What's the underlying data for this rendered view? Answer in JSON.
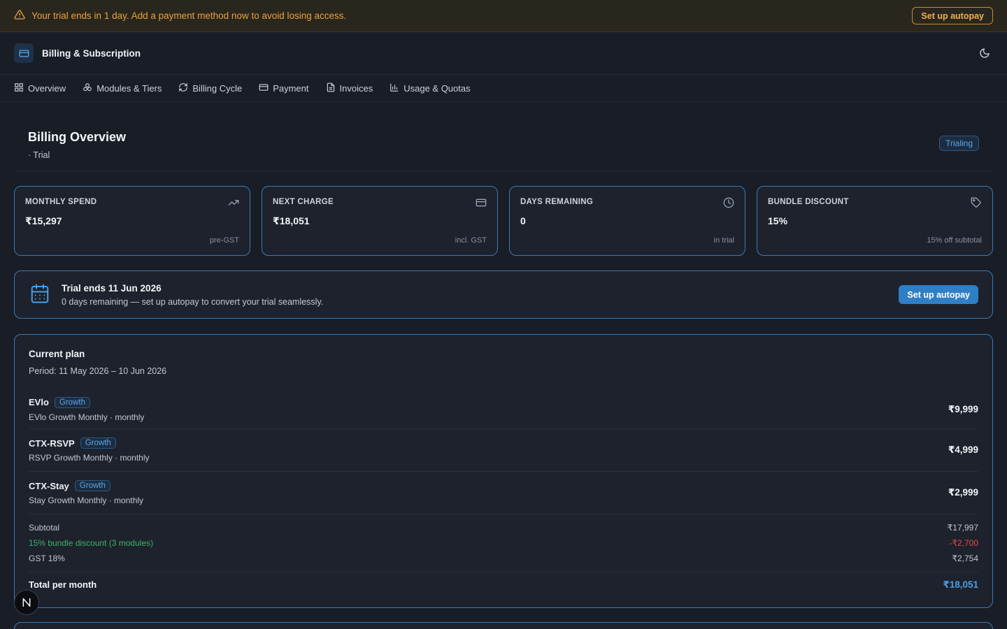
{
  "banner": {
    "message": "Your trial ends in 1 day. Add a payment method now to avoid losing access.",
    "button": "Set up autopay"
  },
  "header": {
    "title": "Billing & Subscription"
  },
  "tabs": [
    {
      "label": "Overview",
      "icon": "grid-icon"
    },
    {
      "label": "Modules & Tiers",
      "icon": "modules-icon"
    },
    {
      "label": "Billing Cycle",
      "icon": "refresh-icon"
    },
    {
      "label": "Payment",
      "icon": "card-icon"
    },
    {
      "label": "Invoices",
      "icon": "document-icon"
    },
    {
      "label": "Usage & Quotas",
      "icon": "bar-chart-icon"
    }
  ],
  "page": {
    "title": "Billing Overview",
    "subtitle": "· Trial",
    "status": "Trialing"
  },
  "stats": [
    {
      "label": "MONTHLY SPEND",
      "value": "₹15,297",
      "note": "pre-GST",
      "icon": "trend-up-icon"
    },
    {
      "label": "NEXT CHARGE",
      "value": "₹18,051",
      "note": "incl. GST",
      "icon": "card-icon"
    },
    {
      "label": "DAYS REMAINING",
      "value": "0",
      "note": "in trial",
      "icon": "clock-icon"
    },
    {
      "label": "BUNDLE DISCOUNT",
      "value": "15%",
      "note": "15% off subtotal",
      "icon": "tag-icon"
    }
  ],
  "trial": {
    "title": "Trial ends 11 Jun 2026",
    "description": "0 days remaining — set up autopay to convert your trial seamlessly.",
    "button": "Set up autopay"
  },
  "plan": {
    "title": "Current plan",
    "period": "Period: 11 May 2026 – 10 Jun 2026",
    "modules": [
      {
        "name": "EVlo",
        "tier": "Growth",
        "description": "EVlo Growth Monthly · monthly",
        "price": "₹9,999"
      },
      {
        "name": "CTX-RSVP",
        "tier": "Growth",
        "description": "RSVP Growth Monthly · monthly",
        "price": "₹4,999"
      },
      {
        "name": "CTX-Stay",
        "tier": "Growth",
        "description": "Stay Growth Monthly · monthly",
        "price": "₹2,999"
      }
    ],
    "subtotal_label": "Subtotal",
    "subtotal": "₹17,997",
    "discount_label": "15% bundle discount (3 modules)",
    "discount": "-₹2,700",
    "gst_label": "GST 18%",
    "gst": "₹2,754",
    "total_label": "Total per month",
    "total": "₹18,051"
  },
  "fab": {
    "label": "N"
  },
  "colors": {
    "accent": "#2f7fc6",
    "warning": "#e9a23b",
    "success": "#3fb46a",
    "danger": "#e5484d",
    "background": "#181d26"
  }
}
